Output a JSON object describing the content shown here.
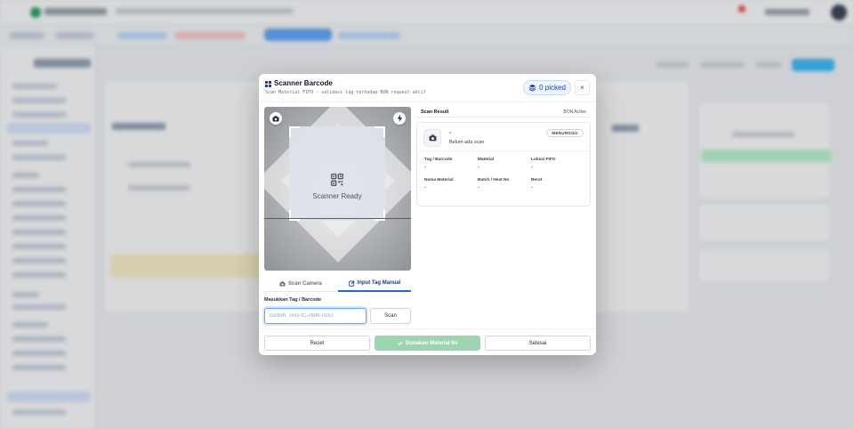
{
  "modal": {
    "title": "Scanner Barcode",
    "subtitle": "Scan Material FIFO - validasi tag terhadap BON request aktif",
    "picked_label": "0 picked",
    "close_glyph": "×"
  },
  "camera": {
    "ready_text": "Scanner Ready"
  },
  "tabs": [
    {
      "label": "Scan Camera",
      "icon": "camera-icon",
      "active": false
    },
    {
      "label": "Input Tag Manual",
      "icon": "edit-icon",
      "active": true
    }
  ],
  "manual": {
    "label": "Masukkan Tag / Barcode",
    "value": "",
    "placeholder": "contoh: TAG-IC-2606-0182",
    "scan_button": "Scan"
  },
  "result": {
    "title": "Scan Result",
    "bon_status": "BON Active",
    "name": "-",
    "state_text": "Belum ada scan",
    "badge": "MENUNGGU",
    "fields": [
      {
        "label": "Tag / Barcode",
        "value": "-"
      },
      {
        "label": "Material",
        "value": "-"
      },
      {
        "label": "Lokasi FIFO",
        "value": "-"
      },
      {
        "label": "Nama Material",
        "value": "-"
      },
      {
        "label": "Batch / Heat No",
        "value": "-"
      },
      {
        "label": "Berat",
        "value": "-"
      }
    ]
  },
  "footer": {
    "reset": "Reset",
    "use": "Gunakan Material Ini",
    "done": "Selesai"
  },
  "colors": {
    "accent": "#2563eb",
    "success_disabled": "#9cd6b0",
    "scan_line": "#dc2626"
  }
}
